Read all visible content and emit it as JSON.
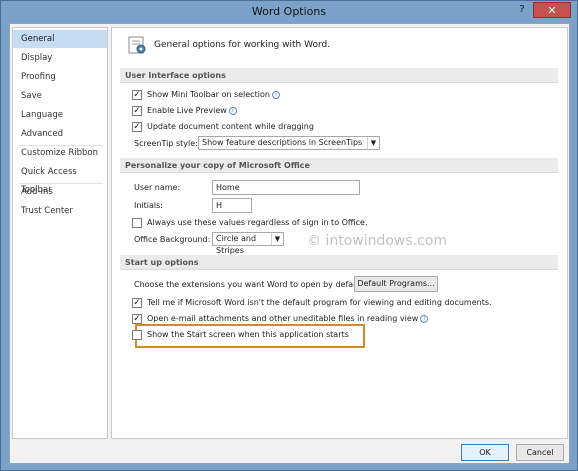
{
  "window": {
    "title": "Word Options",
    "help": "?",
    "close": "✕"
  },
  "nav": {
    "items": [
      {
        "label": "General",
        "selected": true
      },
      {
        "label": "Display"
      },
      {
        "label": "Proofing"
      },
      {
        "label": "Save"
      },
      {
        "label": "Language"
      },
      {
        "label": "Advanced"
      },
      {
        "label": "Customize Ribbon"
      },
      {
        "label": "Quick Access Toolbar"
      },
      {
        "label": "Add-Ins"
      },
      {
        "label": "Trust Center"
      }
    ]
  },
  "header": {
    "text": "General options for working with Word."
  },
  "ui_options": {
    "title": "User Interface options",
    "show_mini_toolbar": {
      "label": "Show Mini Toolbar on selection",
      "checked": true
    },
    "live_preview": {
      "label": "Enable Live Preview",
      "checked": true
    },
    "update_dragging": {
      "label": "Update document content while dragging",
      "checked": true
    },
    "screentip_label": "ScreenTip style:",
    "screentip_value": "Show feature descriptions in ScreenTips"
  },
  "personalize": {
    "title": "Personalize your copy of Microsoft Office",
    "username_label": "User name:",
    "username_value": "Home",
    "initials_label": "Initials:",
    "initials_value": "H",
    "always_use": {
      "label": "Always use these values regardless of sign in to Office.",
      "checked": false
    },
    "background_label": "Office Background:",
    "background_value": "Circle and Stripes"
  },
  "startup": {
    "title": "Start up options",
    "extensions_label": "Choose the extensions you want Word to open by default:",
    "default_programs_button": "Default Programs...",
    "tell_me": {
      "label": "Tell me if Microsoft Word isn't the default program for viewing and editing documents.",
      "checked": true
    },
    "open_email": {
      "label": "Open e-mail attachments and other uneditable files in reading view",
      "checked": true
    },
    "show_start": {
      "label": "Show the Start screen when this application starts",
      "checked": false
    }
  },
  "watermark": "© intowindows.com",
  "footer": {
    "ok": "OK",
    "cancel": "Cancel"
  },
  "colors": {
    "selected_nav": "#c5dcf2",
    "highlight": "#d58a2a",
    "title_bar": "#7ba3c9"
  }
}
